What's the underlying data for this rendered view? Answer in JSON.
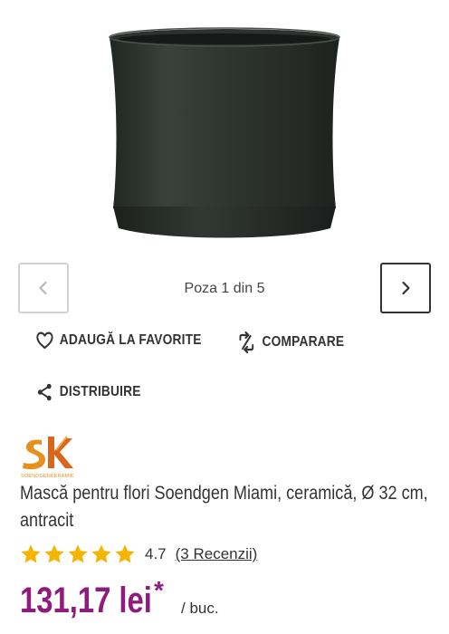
{
  "gallery": {
    "counter": "Poza 1 din 5",
    "prev_icon": "chevron-left-icon",
    "next_icon": "chevron-right-icon"
  },
  "actions": {
    "favorite_label": "ADAUGĂ LA FAVORITE",
    "compare_label": "COMPARARE",
    "share_label": "DISTRIBUIRE"
  },
  "brand": {
    "logo_text": "SOENDGEN KERAMIK",
    "colors": {
      "orange": "#e8901e"
    }
  },
  "product": {
    "title": "Mască pentru flori Soendgen Miami, ceramică, Ø 32 cm, antracit",
    "rating_value": "4.7",
    "reviews_link": "(3 Recenzii)",
    "rating_stars": 4.7,
    "price": "131,17 lei",
    "price_asterisk": "*",
    "unit": "/ buc.",
    "price_color": "#8f1c7d",
    "star_color": "#f5b400"
  }
}
